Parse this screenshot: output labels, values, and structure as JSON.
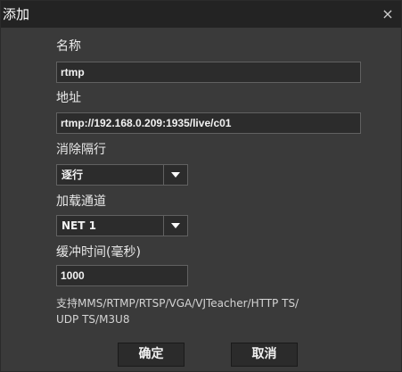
{
  "dialog": {
    "title": "添加",
    "close_label": "×"
  },
  "form": {
    "name_label": "名称",
    "name_value": "rtmp",
    "address_label": "地址",
    "address_value": "rtmp://192.168.0.209:1935/live/c01",
    "deinterlace_label": "消除隔行",
    "deinterlace_value": "逐行",
    "channel_label": "加载通道",
    "channel_value": "NET 1",
    "buffer_label": "缓冲时间(毫秒)",
    "buffer_value": "1000",
    "support_note_line1": "支持MMS/RTMP/RTSP/VGA/VJTeacher/HTTP TS/",
    "support_note_line2": "UDP TS/M3U8"
  },
  "buttons": {
    "ok": "确定",
    "cancel": "取消"
  }
}
